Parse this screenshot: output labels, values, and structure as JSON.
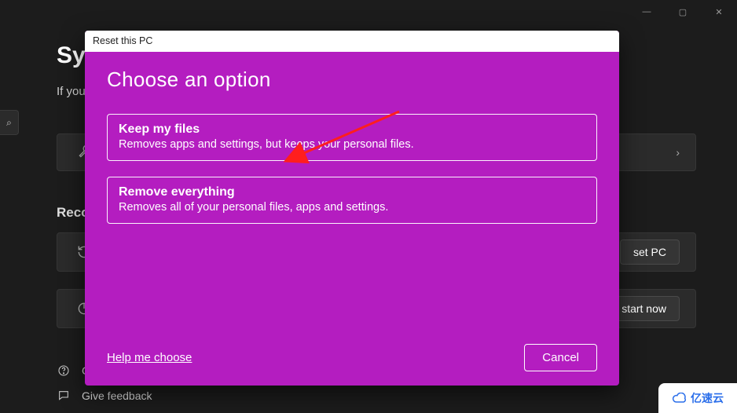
{
  "window": {
    "minimize": "—",
    "maximize": "▢",
    "close": "✕"
  },
  "page": {
    "title_partial": "Sys",
    "subtitle_partial": "If you",
    "search_glyph": "⌕"
  },
  "section": {
    "recovery_label": "Recov"
  },
  "cards": {
    "card1_chevron": "›",
    "card2_button": "set PC",
    "card3_button": "start now"
  },
  "feedback": {
    "row1_label": "G",
    "row2_label": "Give feedback"
  },
  "modal": {
    "title": "Reset this PC",
    "heading": "Choose an option",
    "options": [
      {
        "title": "Keep my files",
        "desc": "Removes apps and settings, but keeps your personal files."
      },
      {
        "title": "Remove everything",
        "desc": "Removes all of your personal files, apps and settings."
      }
    ],
    "help_link": "Help me choose",
    "cancel": "Cancel"
  },
  "annotation": {
    "arrow_color": "#ff1e1e"
  },
  "watermark": {
    "text": "亿速云"
  }
}
